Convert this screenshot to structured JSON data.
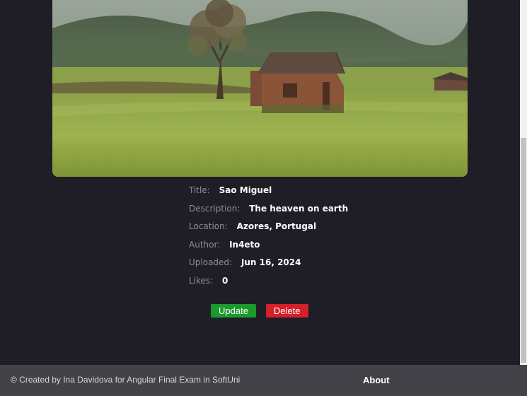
{
  "photo": {
    "alt": "Sao Miguel"
  },
  "details": {
    "title": {
      "label": "Title:",
      "value": "Sao Miguel"
    },
    "description": {
      "label": "Description:",
      "value": "The heaven on earth"
    },
    "location": {
      "label": "Location:",
      "value": "Azores, Portugal"
    },
    "author": {
      "label": "Author:",
      "value": "In4eto"
    },
    "uploaded": {
      "label": "Uploaded:",
      "value": "Jun 16, 2024"
    },
    "likes": {
      "label": "Likes:",
      "value": "0"
    }
  },
  "actions": {
    "update_label": "Update",
    "delete_label": "Delete"
  },
  "footer": {
    "credit": "© Created by Ina Davidova for Angular Final Exam in SoftUni",
    "about_label": "About"
  },
  "colors": {
    "background": "#1f1e27",
    "footer": "#434249",
    "update": "#1b9a2c",
    "delete": "#d42029"
  }
}
